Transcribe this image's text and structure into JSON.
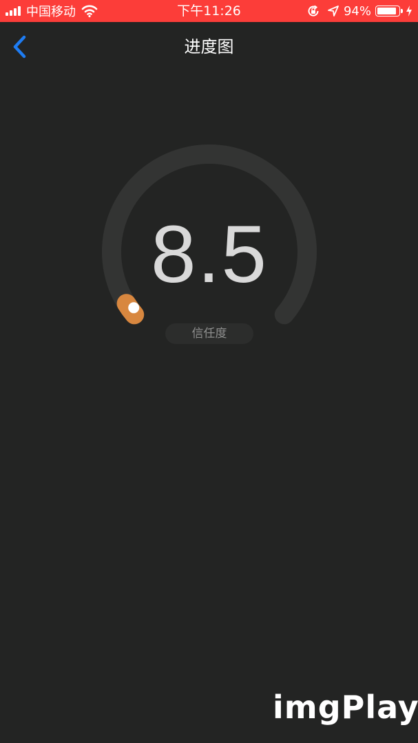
{
  "status_bar": {
    "carrier": "中国移动",
    "time": "下午11:26",
    "battery_percent": "94%",
    "battery_level": 0.94,
    "icons": [
      "signal-icon",
      "wifi-icon",
      "orientation-lock-icon",
      "location-icon",
      "battery-icon",
      "charging-icon"
    ]
  },
  "nav": {
    "title": "进度图",
    "back_icon": "chevron-left-icon"
  },
  "gauge": {
    "value": "8.5",
    "label": "信任度",
    "progress_fraction": 0.0,
    "colors": {
      "track": "#333433",
      "thumb": "#d8873f",
      "thumb_dot": "#ffffff"
    }
  },
  "watermark": {
    "text": "imgPlay"
  },
  "colors": {
    "status_bar_bg": "#fc3d39",
    "background": "#232423",
    "accent": "#1e7cf2"
  }
}
